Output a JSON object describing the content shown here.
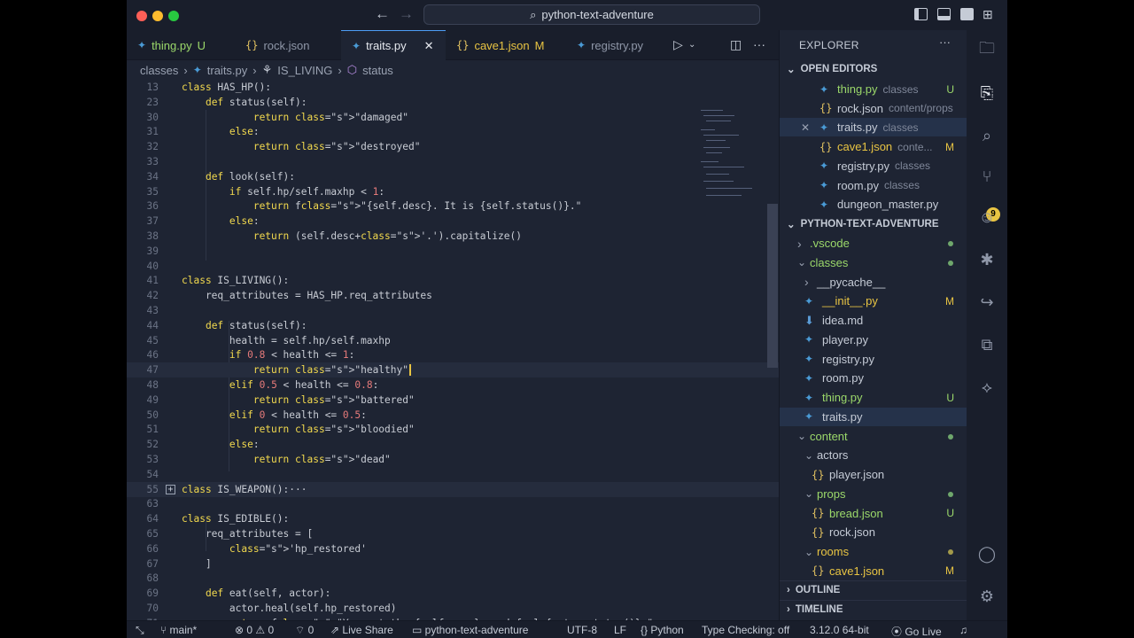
{
  "titlebar": {
    "search": "python-text-adventure"
  },
  "tabs": [
    {
      "name": "thing.py",
      "status": "U",
      "kind": "py"
    },
    {
      "name": "rock.json",
      "kind": "json"
    },
    {
      "name": "traits.py",
      "kind": "py",
      "active": true
    },
    {
      "name": "cave1.json",
      "status": "M",
      "kind": "json"
    },
    {
      "name": "registry.py",
      "kind": "py"
    }
  ],
  "breadcrumb": [
    "classes",
    "traits.py",
    "IS_LIVING",
    "status"
  ],
  "editor": {
    "lines": [
      {
        "n": "13",
        "t": "class HAS_HP():"
      },
      {
        "n": "23",
        "t": "    def status(self):"
      },
      {
        "n": "30",
        "t": "            return \"damaged\""
      },
      {
        "n": "31",
        "t": "        else:"
      },
      {
        "n": "32",
        "t": "            return \"destroyed\""
      },
      {
        "n": "33",
        "t": ""
      },
      {
        "n": "34",
        "t": "    def look(self):"
      },
      {
        "n": "35",
        "t": "        if self.hp/self.maxhp < 1:"
      },
      {
        "n": "36",
        "t": "            return f\"{self.desc}. It is {self.status()}.\""
      },
      {
        "n": "37",
        "t": "        else:"
      },
      {
        "n": "38",
        "t": "            return (self.desc+'.').capitalize()"
      },
      {
        "n": "39",
        "t": ""
      },
      {
        "n": "40",
        "t": ""
      },
      {
        "n": "41",
        "t": "class IS_LIVING():"
      },
      {
        "n": "42",
        "t": "    req_attributes = HAS_HP.req_attributes"
      },
      {
        "n": "43",
        "t": ""
      },
      {
        "n": "44",
        "t": "    def status(self):"
      },
      {
        "n": "45",
        "t": "        health = self.hp/self.maxhp"
      },
      {
        "n": "46",
        "t": "        if 0.8 < health <= 1:"
      },
      {
        "n": "47",
        "t": "            return \"healthy\""
      },
      {
        "n": "48",
        "t": "        elif 0.5 < health <= 0.8:"
      },
      {
        "n": "49",
        "t": "            return \"battered\""
      },
      {
        "n": "50",
        "t": "        elif 0 < health <= 0.5:"
      },
      {
        "n": "51",
        "t": "            return \"bloodied\""
      },
      {
        "n": "52",
        "t": "        else:"
      },
      {
        "n": "53",
        "t": "            return \"dead\""
      },
      {
        "n": "54",
        "t": ""
      },
      {
        "n": "55",
        "t": "class IS_WEAPON():···"
      },
      {
        "n": "63",
        "t": ""
      },
      {
        "n": "64",
        "t": "class IS_EDIBLE():"
      },
      {
        "n": "65",
        "t": "    req_attributes = ["
      },
      {
        "n": "66",
        "t": "        'hp_restored'"
      },
      {
        "n": "67",
        "t": "    ]"
      },
      {
        "n": "68",
        "t": ""
      },
      {
        "n": "69",
        "t": "    def eat(self, actor):"
      },
      {
        "n": "70",
        "t": "        actor.heal(self.hp_restored)"
      },
      {
        "n": "71",
        "t": "        return f\"You eat the {self.name}, and feel {actor.status()}.\""
      }
    ]
  },
  "sidebar": {
    "title": "EXPLORER",
    "open_editors_label": "OPEN EDITORS",
    "open_editors": [
      {
        "name": "thing.py",
        "desc": "classes",
        "status": "U",
        "kind": "py",
        "color": "green"
      },
      {
        "name": "rock.json",
        "desc": "content/props",
        "kind": "json"
      },
      {
        "name": "traits.py",
        "desc": "classes",
        "kind": "py",
        "selected": true,
        "close": "✕"
      },
      {
        "name": "cave1.json",
        "desc": "conte...",
        "status": "M",
        "kind": "json",
        "color": "yellow"
      },
      {
        "name": "registry.py",
        "desc": "classes",
        "kind": "py"
      },
      {
        "name": "room.py",
        "desc": "classes",
        "kind": "py"
      },
      {
        "name": "dungeon_master.py",
        "desc": "",
        "kind": "py"
      }
    ],
    "project_label": "PYTHON-TEXT-ADVENTURE",
    "tree": [
      {
        "name": ".vscode",
        "type": "folder",
        "open": false,
        "indent": 0,
        "color": "green",
        "dot": true
      },
      {
        "name": "classes",
        "type": "folder",
        "open": true,
        "indent": 0,
        "color": "green",
        "dot": true
      },
      {
        "name": "__pycache__",
        "type": "folder",
        "open": false,
        "indent": 1
      },
      {
        "name": "__init__.py",
        "type": "py",
        "indent": 1,
        "status": "M",
        "color": "yellow"
      },
      {
        "name": "idea.md",
        "type": "md",
        "indent": 1
      },
      {
        "name": "player.py",
        "type": "py",
        "indent": 1
      },
      {
        "name": "registry.py",
        "type": "py",
        "indent": 1
      },
      {
        "name": "room.py",
        "type": "py",
        "indent": 1
      },
      {
        "name": "thing.py",
        "type": "py",
        "indent": 1,
        "status": "U",
        "color": "green"
      },
      {
        "name": "traits.py",
        "type": "py",
        "indent": 1,
        "selected": true
      },
      {
        "name": "content",
        "type": "folder",
        "open": true,
        "indent": 0,
        "color": "green",
        "dot": true
      },
      {
        "name": "actors",
        "type": "folder",
        "open": true,
        "indent": 1
      },
      {
        "name": "player.json",
        "type": "json",
        "indent": 2
      },
      {
        "name": "props",
        "type": "folder",
        "open": true,
        "indent": 1,
        "color": "green",
        "dot": true
      },
      {
        "name": "bread.json",
        "type": "json",
        "indent": 2,
        "status": "U",
        "color": "green"
      },
      {
        "name": "rock.json",
        "type": "json",
        "indent": 2
      },
      {
        "name": "rooms",
        "type": "folder",
        "open": true,
        "indent": 1,
        "color": "yellow",
        "dot": true
      },
      {
        "name": "cave1.json",
        "type": "json",
        "indent": 2,
        "status": "M",
        "color": "yellow"
      }
    ],
    "outline_label": "OUTLINE",
    "timeline_label": "TIMELINE"
  },
  "activity": {
    "scm_badge": "9"
  },
  "statusbar": {
    "branch": "main*",
    "problems": "⊗ 0 ⚠ 0",
    "ports": "0",
    "liveshare": "Live Share",
    "folder": "python-text-adventure",
    "encoding": "UTF-8",
    "eol": "LF",
    "language": "Python",
    "typecheck": "Type Checking: off",
    "interpreter": "3.12.0 64-bit",
    "golive": "Go Live"
  },
  "colors": {
    "accent": "#4d9df5",
    "keyword": "#f2d94e",
    "number": "#e57a7a",
    "untracked": "#9bd86a",
    "modified": "#e8c443"
  }
}
